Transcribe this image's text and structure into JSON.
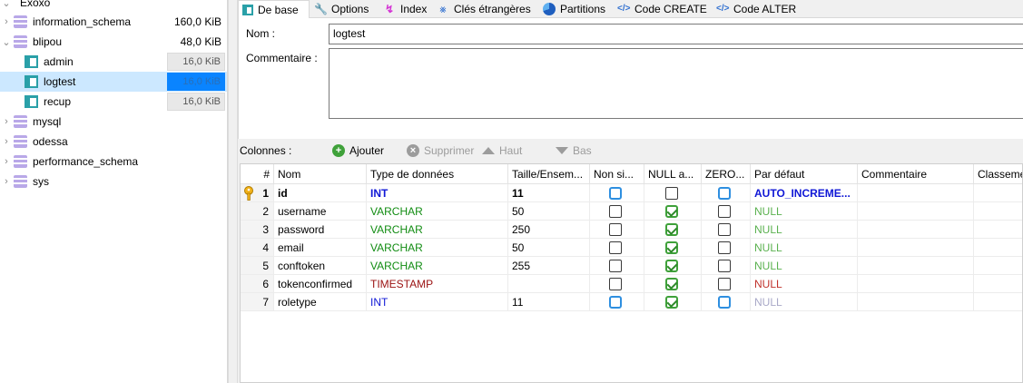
{
  "sidebar": {
    "items": [
      {
        "label": "Exoxo",
        "size": ""
      },
      {
        "label": "information_schema",
        "size": "160,0 KiB"
      },
      {
        "label": "blipou",
        "size": "48,0 KiB"
      },
      {
        "label": "admin",
        "size": "16,0 KiB"
      },
      {
        "label": "logtest",
        "size": "16,0 KiB"
      },
      {
        "label": "recup",
        "size": "16,0 KiB"
      },
      {
        "label": "mysql",
        "size": ""
      },
      {
        "label": "odessa",
        "size": ""
      },
      {
        "label": "performance_schema",
        "size": ""
      },
      {
        "label": "sys",
        "size": ""
      }
    ]
  },
  "tabs": [
    {
      "label": "De base",
      "icon": "table-icon"
    },
    {
      "label": "Options",
      "icon": "wrench-icon"
    },
    {
      "label": "Index",
      "icon": "lightning-icon"
    },
    {
      "label": "Clés étrangères",
      "icon": "foreign-key-icon"
    },
    {
      "label": "Partitions",
      "icon": "pie-icon"
    },
    {
      "label": "Code CREATE",
      "icon": "code-icon"
    },
    {
      "label": "Code ALTER",
      "icon": "code-icon"
    }
  ],
  "form": {
    "name_label": "Nom :",
    "name_value": "logtest",
    "comment_label": "Commentaire :",
    "comment_value": ""
  },
  "columns_toolbar": {
    "label": "Colonnes :",
    "add": "Ajouter",
    "remove": "Supprimer",
    "up": "Haut",
    "down": "Bas"
  },
  "grid": {
    "headers": [
      "#",
      "Nom",
      "Type de données",
      "Taille/Ensem...",
      "Non si...",
      "NULL a...",
      "ZERO...",
      "Par défaut",
      "Commentaire",
      "Classeme"
    ],
    "rows": [
      {
        "num": "1",
        "name": "id",
        "type": "INT",
        "size": "11",
        "unsigned": false,
        "allow_null": false,
        "zerofill": false,
        "default": "AUTO_INCREME..."
      },
      {
        "num": "2",
        "name": "username",
        "type": "VARCHAR",
        "size": "50",
        "unsigned": false,
        "allow_null": true,
        "zerofill": false,
        "default": "NULL"
      },
      {
        "num": "3",
        "name": "password",
        "type": "VARCHAR",
        "size": "250",
        "unsigned": false,
        "allow_null": true,
        "zerofill": false,
        "default": "NULL"
      },
      {
        "num": "4",
        "name": "email",
        "type": "VARCHAR",
        "size": "50",
        "unsigned": false,
        "allow_null": true,
        "zerofill": false,
        "default": "NULL"
      },
      {
        "num": "5",
        "name": "conftoken",
        "type": "VARCHAR",
        "size": "255",
        "unsigned": false,
        "allow_null": true,
        "zerofill": false,
        "default": "NULL"
      },
      {
        "num": "6",
        "name": "tokenconfirmed",
        "type": "TIMESTAMP",
        "size": "",
        "unsigned": false,
        "allow_null": true,
        "zerofill": false,
        "default": "NULL"
      },
      {
        "num": "7",
        "name": "roletype",
        "type": "INT",
        "size": "11",
        "unsigned": false,
        "allow_null": true,
        "zerofill": false,
        "default": "NULL"
      }
    ]
  },
  "colors": {
    "selection": "#cce8ff",
    "int_type": "#1018d6",
    "varchar_type": "#118c12",
    "timestamp_type": "#9a1010",
    "add_icon": "#3fa13a"
  }
}
